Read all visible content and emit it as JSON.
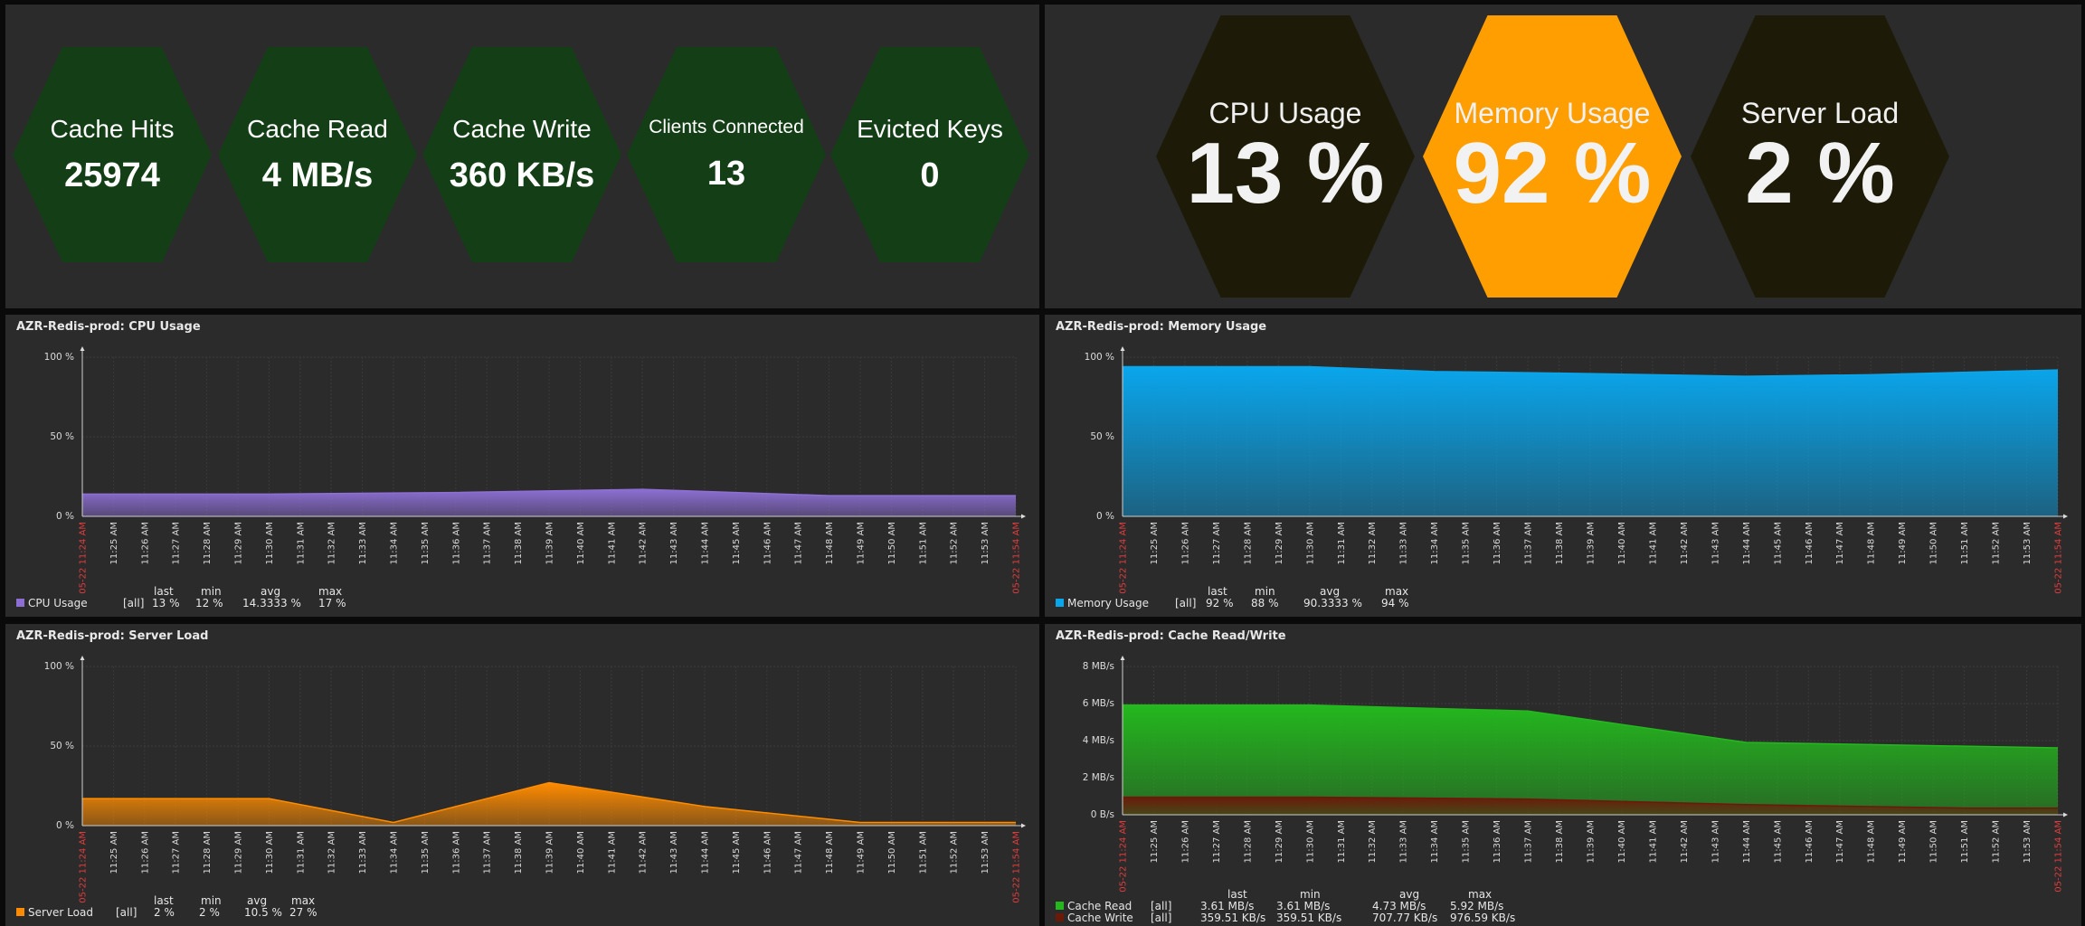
{
  "stats_left": [
    {
      "label": "Cache Hits",
      "value": "25974"
    },
    {
      "label": "Cache Read",
      "value": "4 MB/s"
    },
    {
      "label": "Cache Write",
      "value": "360 KB/s"
    },
    {
      "label": "Clients Connected",
      "value": "13"
    },
    {
      "label": "Evicted Keys",
      "value": "0"
    }
  ],
  "stats_right": [
    {
      "label": "CPU Usage",
      "value": "13 %",
      "color": "#1d1b07"
    },
    {
      "label": "Memory Usage",
      "value": "92 %",
      "color": "#ff9e00"
    },
    {
      "label": "Server Load",
      "value": "2 %",
      "color": "#1d1b07"
    }
  ],
  "colors": {
    "hex_green": "#143f16",
    "panel": "#2b2b2b",
    "time_start_end": "#e03c3c"
  },
  "time_labels": [
    "11:25 AM",
    "11:26 AM",
    "11:27 AM",
    "11:28 AM",
    "11:29 AM",
    "11:30 AM",
    "11:31 AM",
    "11:32 AM",
    "11:33 AM",
    "11:34 AM",
    "11:35 AM",
    "11:36 AM",
    "11:37 AM",
    "11:38 AM",
    "11:39 AM",
    "11:40 AM",
    "11:41 AM",
    "11:42 AM",
    "11:43 AM",
    "11:44 AM",
    "11:45 AM",
    "11:46 AM",
    "11:47 AM",
    "11:48 AM",
    "11:49 AM",
    "11:50 AM",
    "11:51 AM",
    "11:52 AM",
    "11:53 AM"
  ],
  "time_start": "05-22 11:24 AM",
  "time_end": "05-22 11:54 AM",
  "legend_headers": [
    "last",
    "min",
    "avg",
    "max"
  ],
  "chart_data": [
    {
      "type": "area",
      "title": "AZR-Redis-prod: CPU Usage",
      "y_ticks": [
        "100 %",
        "50 %",
        "0 %"
      ],
      "ylim": [
        0,
        100
      ],
      "x_minutes": [
        0,
        6,
        12,
        18,
        24,
        30
      ],
      "series": [
        {
          "name": "CPU Usage",
          "scope": "[all]",
          "color": "#8d6fd4",
          "values": [
            14,
            14,
            15,
            17,
            13,
            13
          ],
          "last": "13 %",
          "min": "12 %",
          "avg": "14.3333 %",
          "max": "17 %"
        }
      ]
    },
    {
      "type": "area",
      "title": "AZR-Redis-prod: Memory Usage",
      "y_ticks": [
        "100 %",
        "50 %",
        "0 %"
      ],
      "ylim": [
        0,
        100
      ],
      "x_minutes": [
        0,
        6,
        10,
        14,
        20,
        24,
        30
      ],
      "series": [
        {
          "name": "Memory Usage",
          "scope": "[all]",
          "color": "#0aa6ec",
          "values": [
            94,
            94,
            91,
            90,
            88,
            89,
            92
          ],
          "last": "92 %",
          "min": "88 %",
          "avg": "90.3333 %",
          "max": "94 %"
        }
      ]
    },
    {
      "type": "area",
      "title": "AZR-Redis-prod: Server Load",
      "y_ticks": [
        "100 %",
        "50 %",
        "0 %"
      ],
      "ylim": [
        0,
        100
      ],
      "x_minutes": [
        0,
        6,
        10,
        15,
        20,
        25,
        30
      ],
      "series": [
        {
          "name": "Server Load",
          "scope": "[all]",
          "color": "#ff8c00",
          "values": [
            17,
            17,
            2,
            27,
            12,
            2,
            2
          ],
          "last": "2 %",
          "min": "2 %",
          "avg": "10.5 %",
          "max": "27 %"
        }
      ]
    },
    {
      "type": "area",
      "title": "AZR-Redis-prod: Cache Read/Write",
      "y_ticks": [
        "8 MB/s",
        "6 MB/s",
        "4 MB/s",
        "2 MB/s",
        "0 B/s"
      ],
      "ylim": [
        0,
        8
      ],
      "x_minutes": [
        0,
        6,
        13,
        20,
        27,
        30
      ],
      "series": [
        {
          "name": "Cache Read",
          "scope": "[all]",
          "color": "#24b81e",
          "values": [
            5.92,
            5.92,
            5.6,
            3.9,
            3.7,
            3.61
          ],
          "last": "3.61 MB/s",
          "min": "3.61 MB/s",
          "avg": "4.73 MB/s",
          "max": "5.92 MB/s"
        },
        {
          "name": "Cache Write",
          "scope": "[all]",
          "color": "#6b1a0a",
          "values": [
            0.95,
            0.95,
            0.85,
            0.55,
            0.36,
            0.36
          ],
          "last": "359.51 KB/s",
          "min": "359.51 KB/s",
          "avg": "707.77 KB/s",
          "max": "976.59 KB/s"
        }
      ]
    }
  ]
}
